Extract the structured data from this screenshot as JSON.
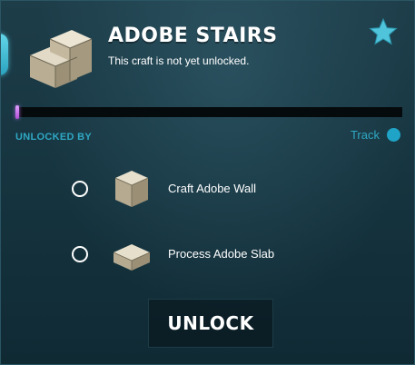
{
  "header": {
    "title": "ADOBE STAIRS",
    "subtitle": "This craft is not yet unlocked.",
    "icon": "adobe-stairs-icon",
    "favorite_icon": "star-icon"
  },
  "progress": {
    "value": 0.01,
    "color": "#c06ae0"
  },
  "requirements": {
    "heading": "UNLOCKED BY",
    "track_label": "Track",
    "items": [
      {
        "label": "Craft Adobe Wall",
        "icon": "adobe-wall-icon"
      },
      {
        "label": "Process Adobe Slab",
        "icon": "adobe-slab-icon"
      }
    ]
  },
  "actions": {
    "unlock_label": "UNLOCK"
  },
  "colors": {
    "accent": "#2fa8c4",
    "background": "#163540",
    "stone": "#c9bfa6"
  }
}
